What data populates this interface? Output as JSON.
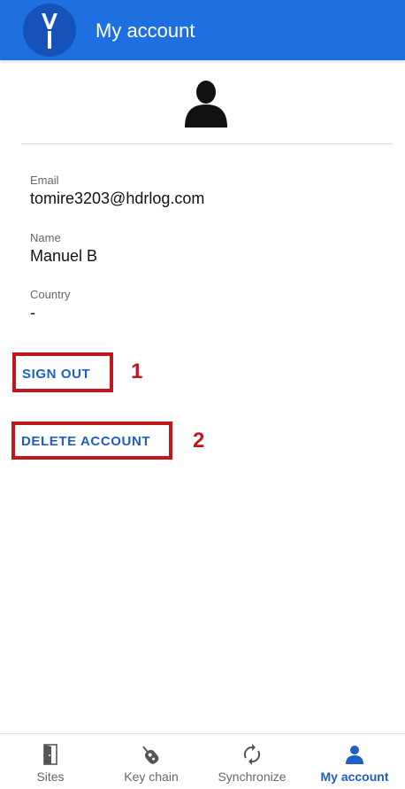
{
  "header": {
    "title": "My account"
  },
  "profile": {
    "email_label": "Email",
    "email_value": "tomire3203@hdrlog.com",
    "name_label": "Name",
    "name_value": "Manuel B",
    "country_label": "Country",
    "country_value": "-"
  },
  "actions": {
    "sign_out_label": "SIGN OUT",
    "delete_account_label": "DELETE ACCOUNT"
  },
  "annotations": {
    "sign_out_number": "1",
    "delete_account_number": "2",
    "color": "#c0161c"
  },
  "bottom_nav": {
    "items": [
      {
        "label": "Sites",
        "icon": "door-icon"
      },
      {
        "label": "Key chain",
        "icon": "key-chain-icon"
      },
      {
        "label": "Synchronize",
        "icon": "sync-icon"
      },
      {
        "label": "My account",
        "icon": "person-icon",
        "active": true
      }
    ]
  },
  "colors": {
    "primary": "#1e6fe0",
    "accent_text": "#1d5fc4"
  }
}
